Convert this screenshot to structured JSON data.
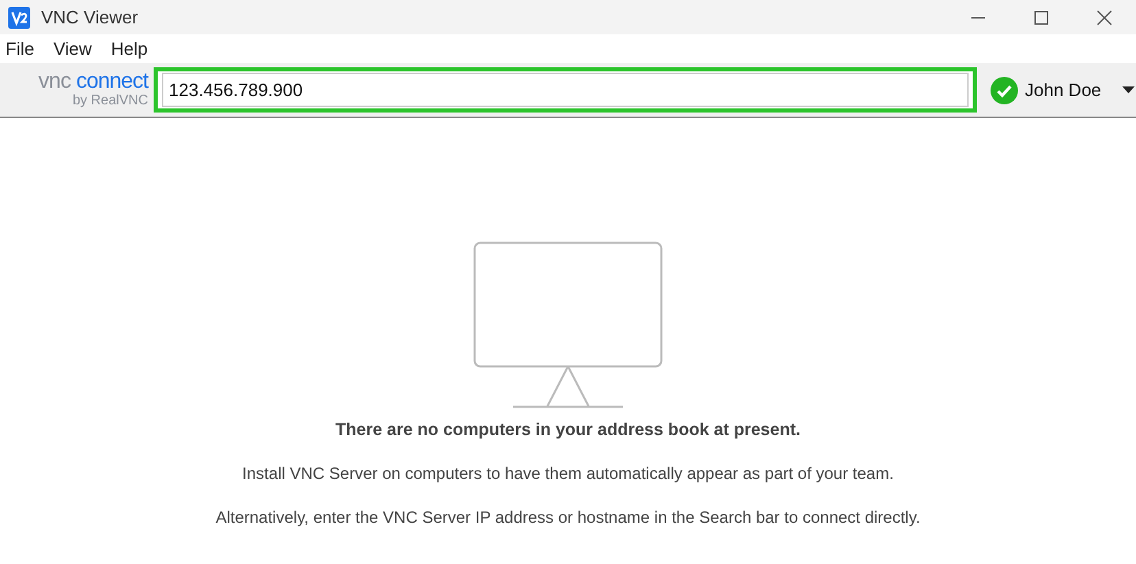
{
  "window": {
    "title": "VNC Viewer"
  },
  "menu": [
    "File",
    "View",
    "Help"
  ],
  "logo": {
    "brand_a": "vnc",
    "brand_b": "connect",
    "byline": "by RealVNC"
  },
  "search": {
    "value": "123.456.789.900",
    "focused": true
  },
  "account": {
    "name": "John Doe",
    "signed_in": true
  },
  "empty_state": {
    "heading": "There are no computers in your address book at present.",
    "lines": [
      "Install VNC Server on computers to have them automatically appear as part of your team.",
      "Alternatively, enter the VNC Server IP address or hostname in the Search bar to connect directly."
    ]
  }
}
